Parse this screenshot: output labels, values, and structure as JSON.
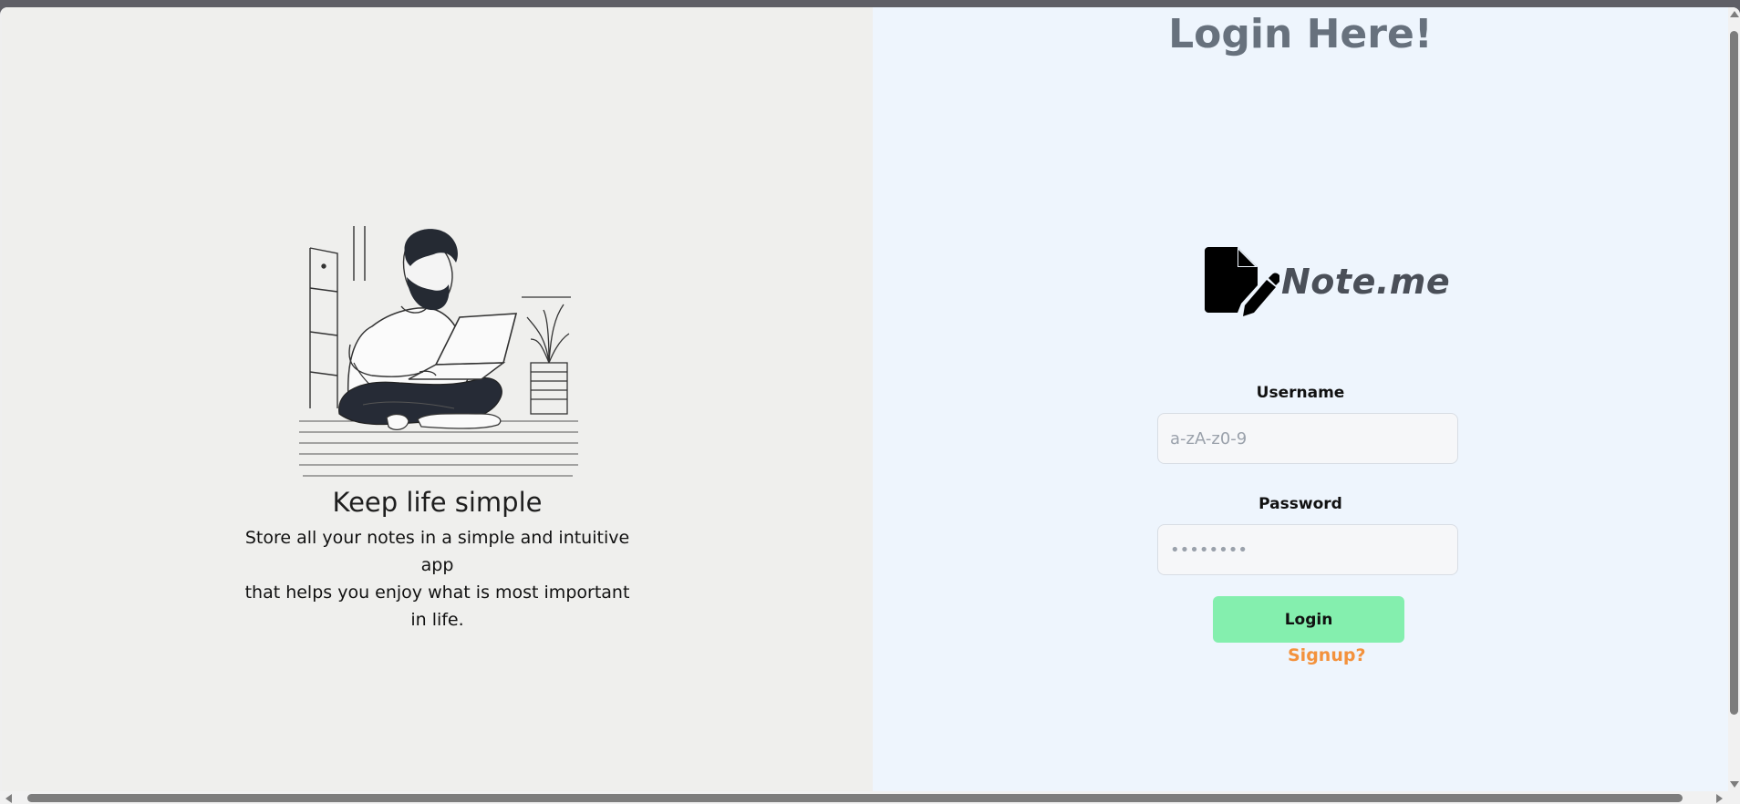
{
  "left": {
    "tagline": "Keep life simple",
    "description_lines": [
      "Store all your notes in a simple and intuitive app",
      "that helps you enjoy what is most important",
      "in life."
    ]
  },
  "right": {
    "title": "Login Here!",
    "logo_text": "Note.me",
    "username": {
      "label": "Username",
      "placeholder": "a-zA-z0-9",
      "value": ""
    },
    "password": {
      "label": "Password",
      "placeholder": "••••••••",
      "value": ""
    },
    "login_label": "Login",
    "signup_label": "Signup?"
  },
  "colors": {
    "left_bg": "#efefed",
    "right_bg": "#eef5fd",
    "title": "#67717d",
    "login_button": "#84efae",
    "signup_link": "#f3923d"
  },
  "icons": {
    "logo": "file-pen-icon",
    "illustration": "man-with-laptop-illustration"
  }
}
